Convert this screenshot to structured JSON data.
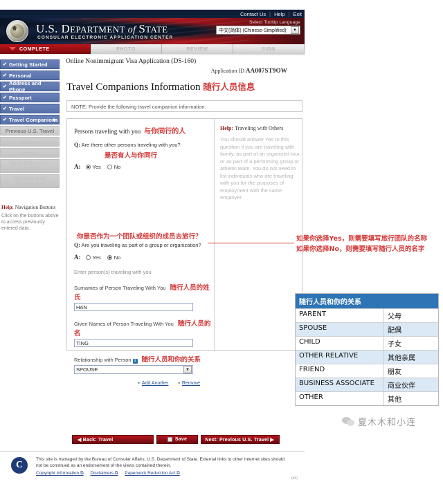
{
  "topbar": {
    "links": [
      "Contact Us",
      "Help",
      "Exit"
    ],
    "separator": "|"
  },
  "banner": {
    "dept_us": "U.S. ",
    "dept_department": "D",
    "dept_epartment": "EPARTMENT",
    "dept_of": " of ",
    "dept_s": "S",
    "dept_tate": "TATE",
    "subtitle": "CONSULAR ELECTRONIC APPLICATION CENTER",
    "lang_label": "Select Tooltip Language",
    "lang_value": "中文(简体) (Chinese-Simplified)",
    "lang_arrow": "▼"
  },
  "tabs": [
    {
      "label": "COMPLETE",
      "active": true
    },
    {
      "label": "PHOTO",
      "active": false
    },
    {
      "label": "REVIEW",
      "active": false
    },
    {
      "label": "SIGN",
      "active": false
    }
  ],
  "sidebar": {
    "items": [
      {
        "label": "Getting Started",
        "state": "done",
        "check": "✔"
      },
      {
        "label": "Personal",
        "state": "done",
        "check": "✔"
      },
      {
        "label": "Address and Phone",
        "state": "done",
        "check": "✔"
      },
      {
        "label": "Passport",
        "state": "done",
        "check": "✔"
      },
      {
        "label": "Travel",
        "state": "done",
        "check": "✔"
      },
      {
        "label": "Travel Companions",
        "state": "current",
        "check": "✔"
      },
      {
        "label": "Previous U.S. Travel",
        "state": "semi",
        "check": ""
      },
      {
        "label": "Additional",
        "state": "ghost",
        "check": ""
      },
      {
        "label": "Family",
        "state": "ghost",
        "check": ""
      },
      {
        "label": "Work/Education/",
        "label2": "Training",
        "state": "ghost-tall",
        "check": ""
      },
      {
        "label": "Security and",
        "label2": "Background",
        "state": "ghost-tall",
        "check": ""
      }
    ],
    "help_title_bold": "Help:",
    "help_title_rest": " Navigation Buttons",
    "help_text": "Click on the buttons above to access previously entered data."
  },
  "main": {
    "app_title": "Online Nonimmigrant Visa Application (DS-160)",
    "app_id_label": "Application ID ",
    "app_id_value": "AA007ST9OW",
    "page_title": "Travel Companions Information",
    "page_title_cn": "随行人员信息",
    "note": "NOTE: Provide the following travel companion information.",
    "section_label": "Persons traveling with you",
    "section_label_cn": "与你同行的人",
    "q1_prefix": "Q:",
    "q1_text": " Are there other persons traveling with you?",
    "q1_cn": "是否有人与你同行",
    "a_prefix": "A:",
    "yes_label": "Yes",
    "no_label": "No",
    "q2_cn": "你是否作为一个团队或组织的成员去旅行？",
    "q2_prefix": "Q:",
    "q2_text": " Are you traveling as part of a group or organization?",
    "hint": "Enter person(s) traveling with you",
    "surname_label": "Surnames of Person Traveling With You",
    "surname_label_cn": "随行人员的姓氏",
    "surname_value": "HAN",
    "given_label": "Given Names of Person Traveling With You",
    "given_label_cn": "随行人员的名",
    "given_value": "TING",
    "relationship_label": "Relationship with Person",
    "relationship_badge": "i",
    "relationship_label_cn": "随行人员和你的关系",
    "relationship_value": "SPOUSE",
    "select_arrow": "▼",
    "add_another": "Add Another",
    "remove": "Remove",
    "bullet": "▪",
    "help_title_bold": "Help:",
    "help_title_rest": " Traveling with Others",
    "help_text": "You should answer Yes to this question if you are traveling with family, as part of an organized tour, or as part of a performing group or athletic team. You do not need to list individuals who are traveling with you for the purposes of employment with the same employer."
  },
  "navbuttons": {
    "back": "◀ Back: Travel",
    "save": "Save",
    "next": "Next: Previous U.S. Travel ▶"
  },
  "footer": {
    "text": "This site is managed by the Bureau of Consular Affairs, U.S. Department of State. External links to other Internet sites should not be construed as an endorsement of the views contained therein.",
    "links": [
      "Copyright Information ⧉",
      "Disclaimers ⧉",
      "Paperwork Reduction Act ⧉"
    ],
    "small": "(b4)",
    "seal_letter": "C"
  },
  "annotations": {
    "line1": "如果你选择Yes，则需要填写旅行团队的名称",
    "line2": "如果你选择No，则需要填写随行人员的名字"
  },
  "relationship_table": {
    "header": "随行人员和你的关系",
    "rows": [
      {
        "en": "PARENT",
        "cn": "父母"
      },
      {
        "en": "SPOUSE",
        "cn": "配偶"
      },
      {
        "en": "CHILD",
        "cn": "子女"
      },
      {
        "en": "OTHER RELATIVE",
        "cn": "其他亲属"
      },
      {
        "en": "FRIEND",
        "cn": "朋友"
      },
      {
        "en": "BUSINESS ASSOCIATE",
        "cn": "商业伙伴"
      },
      {
        "en": "OTHER",
        "cn": "其他"
      }
    ]
  },
  "watermark": {
    "text": "夏木木和小连"
  },
  "colors": {
    "brand_red": "#9a0f14",
    "annotation_red": "#d33a3a",
    "table_header_blue": "#2e75b6",
    "nav_blue": "#5670a9"
  }
}
